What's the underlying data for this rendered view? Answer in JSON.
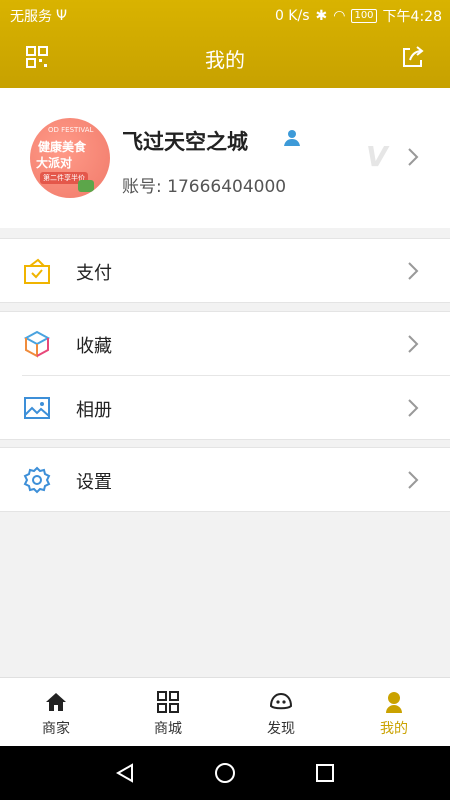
{
  "status_bar": {
    "carrier": "无服务",
    "speed": "0 K/s",
    "battery": "100",
    "time": "下午4:28"
  },
  "header": {
    "title": "我的",
    "left_icon": "qr-grid-icon",
    "right_icon": "share-icon",
    "accent_color": "#d4ad00"
  },
  "profile": {
    "name": "飞过天空之城",
    "account_label": "账号:",
    "account_number": "17666404000",
    "vip_badge": "V",
    "avatar_text": {
      "line1": "OD FESTIVAL",
      "line2": "健康美食",
      "line3": "大派对",
      "line4": "第二件享半价"
    }
  },
  "menu": {
    "groups": [
      {
        "items": [
          {
            "label": "支付",
            "icon": "wallet-icon"
          }
        ]
      },
      {
        "items": [
          {
            "label": "收藏",
            "icon": "cube-icon"
          },
          {
            "label": "相册",
            "icon": "image-icon"
          }
        ]
      },
      {
        "items": [
          {
            "label": "设置",
            "icon": "gear-icon"
          }
        ]
      }
    ]
  },
  "tabbar": {
    "tabs": [
      {
        "label": "商家",
        "icon": "home-icon"
      },
      {
        "label": "商城",
        "icon": "grid-icon"
      },
      {
        "label": "发现",
        "icon": "discover-face-icon"
      },
      {
        "label": "我的",
        "icon": "user-icon",
        "active": true
      }
    ],
    "active_color": "#caa200"
  }
}
